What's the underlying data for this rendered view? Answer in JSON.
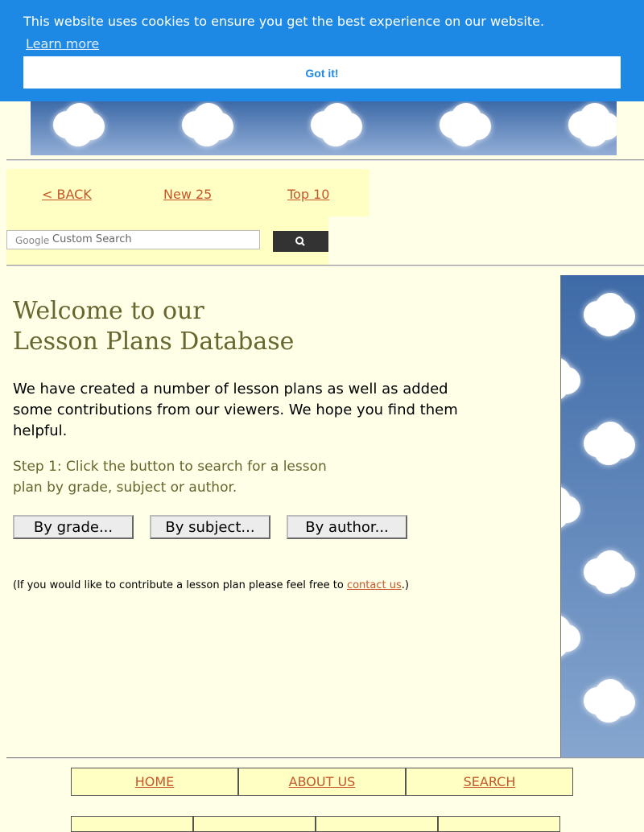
{
  "cookie_banner": {
    "message": "This website uses cookies to ensure you get the best experience on our website.",
    "learn_more": "Learn more",
    "button": "Got it!"
  },
  "nav": {
    "back": "< BACK",
    "new25": "New 25",
    "top10": "Top 10"
  },
  "search": {
    "placeholder": "Custom Search",
    "brand": "Google",
    "button_icon": "search-icon"
  },
  "main": {
    "title_line1": "Welcome to our",
    "title_line2": "Lesson Plans Database",
    "intro": "We have created a number of lesson plans as well as added some contributions from our viewers.  We hope you find them helpful.",
    "step": "Step 1:  Click the button to search for a lesson plan by grade, subject or author.",
    "buttons": {
      "grade": "By grade...",
      "subject": "By subject...",
      "author": "By author..."
    },
    "contrib_before": "(If you would like to contribute a lesson plan please feel free to ",
    "contrib_link": "contact us",
    "contrib_after": ".)"
  },
  "footer": {
    "home": "HOME",
    "about": "ABOUT US",
    "search": "SEARCH"
  },
  "colors": {
    "background": "#ffffe8",
    "cookie_bar": "#1e88e5",
    "link": "#c6562a",
    "heading": "#66662e",
    "nav_box": "#ffffc4"
  }
}
